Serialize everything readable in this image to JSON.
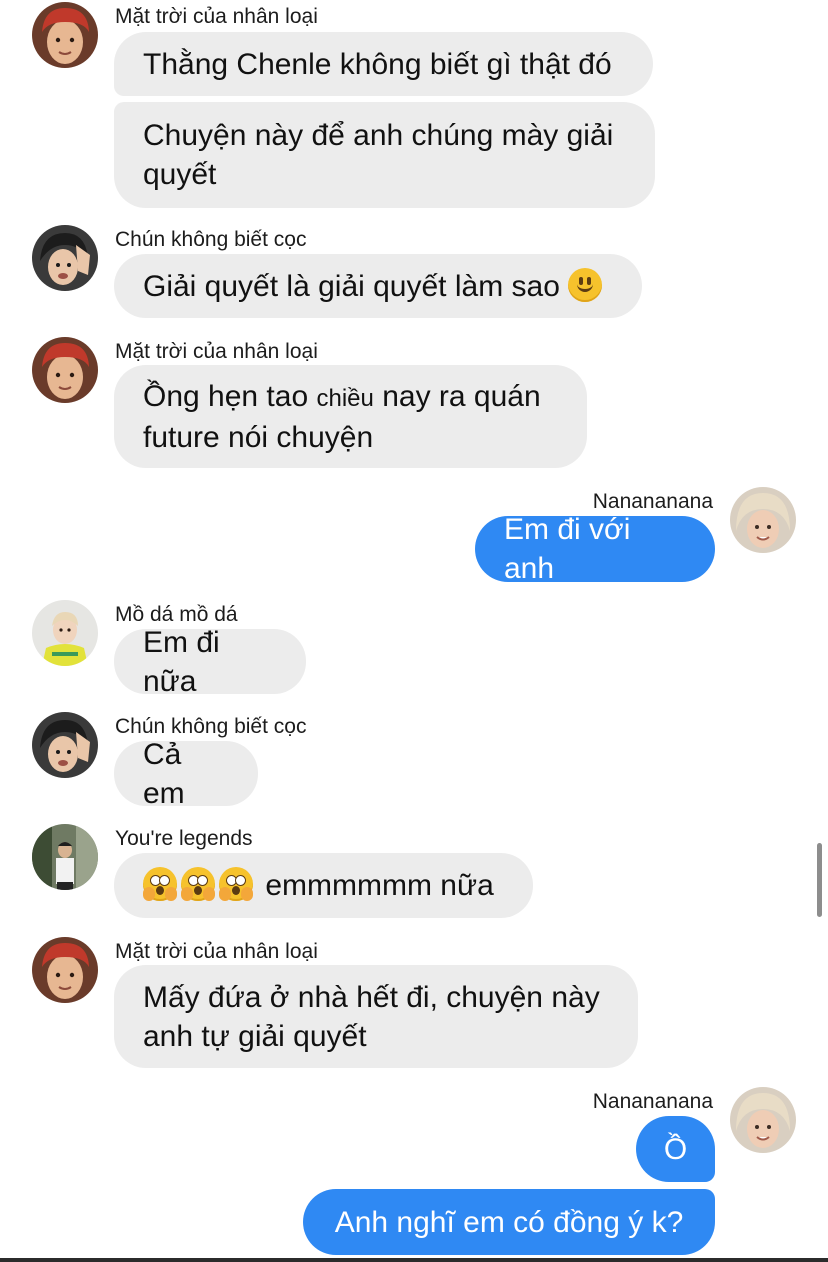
{
  "messages": [
    {
      "sender": "Mặt trời của nhân loại",
      "avatar": "avatar-red-hair",
      "direction": "in",
      "bubbles": [
        "Thằng Chenle không biết gì thật đó",
        "Chuyện này để anh chúng mày giải quyết"
      ]
    },
    {
      "sender": "Chún không biết cọc",
      "avatar": "avatar-hand-on-head",
      "direction": "in",
      "bubbles": [
        "Giải quyết là giải quyết làm sao",
        "smiley-emoji"
      ]
    },
    {
      "sender": "Mặt trời của nhân loại",
      "avatar": "avatar-red-hair",
      "direction": "in",
      "bubbles_parts": [
        "Ồng  hẹn tao",
        "chiều",
        "nay ra quán future nói chuyện"
      ]
    },
    {
      "sender": "Nanananana",
      "avatar": "avatar-blonde",
      "direction": "out",
      "bubbles": [
        "Em đi với anh"
      ]
    },
    {
      "sender": "Mồ dá mồ dá",
      "avatar": "avatar-yellow-shirt",
      "direction": "in",
      "bubbles": [
        "Em đi nữa"
      ]
    },
    {
      "sender": "Chún không biết cọc",
      "avatar": "avatar-hand-on-head",
      "direction": "in",
      "bubbles": [
        "Cả em"
      ]
    },
    {
      "sender": "You're legends",
      "avatar": "avatar-outdoor",
      "direction": "in",
      "bubbles": [
        "emmmmmm nữa"
      ],
      "emoji": "shocked-face-emoji"
    },
    {
      "sender": "Mặt trời của nhân loại",
      "avatar": "avatar-red-hair",
      "direction": "in",
      "bubbles": [
        "Mấy đứa ở nhà hết đi, chuyện này anh tự giải quyết"
      ]
    },
    {
      "sender": "Nanananana",
      "avatar": "avatar-blonde",
      "direction": "out",
      "bubbles": [
        "Ồ",
        "Anh nghĩ em có đồng ý k?"
      ]
    }
  ],
  "colors": {
    "incoming_bubble": "#ececec",
    "outgoing_bubble": "#2f89f3",
    "outgoing_text": "#ffffff"
  }
}
